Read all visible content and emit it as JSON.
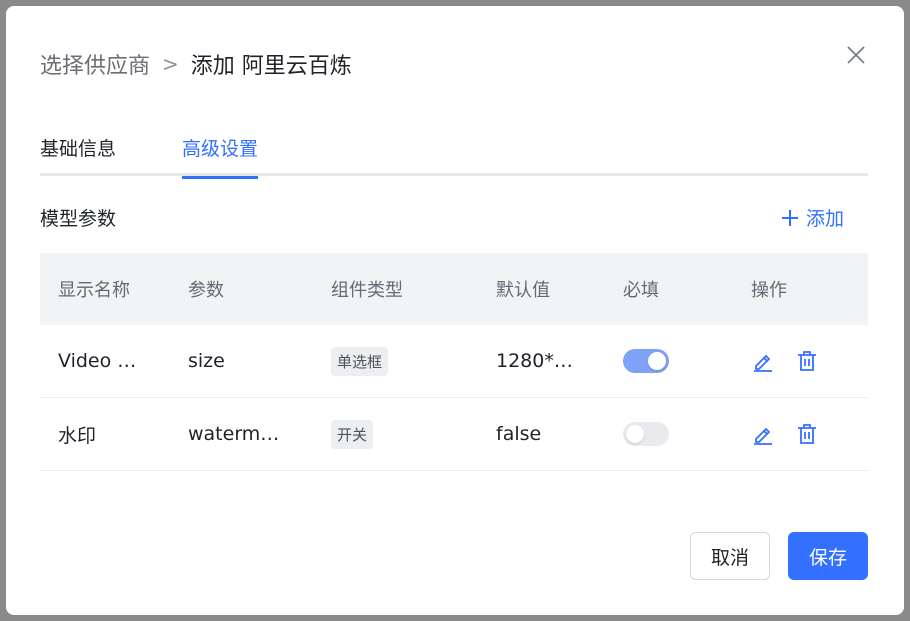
{
  "breadcrumb": {
    "parent": "选择供应商",
    "separator": ">",
    "current": "添加 阿里云百炼"
  },
  "tabs": [
    {
      "label": "基础信息"
    },
    {
      "label": "高级设置"
    }
  ],
  "section": {
    "title": "模型参数",
    "add_label": "添加"
  },
  "table": {
    "headers": [
      "显示名称",
      "参数",
      "组件类型",
      "默认值",
      "必填",
      "操作"
    ],
    "rows": [
      {
        "display_name": "Video …",
        "param": "size",
        "component": "单选框",
        "default": "1280*…",
        "required": true
      },
      {
        "display_name": "水印",
        "param": "waterm…",
        "component": "开关",
        "default": "false",
        "required": false
      }
    ]
  },
  "footer": {
    "cancel_label": "取消",
    "save_label": "保存"
  },
  "colors": {
    "accent": "#3370ff",
    "switch_on": "#7ea2f5",
    "switch_off": "#e8eaed"
  },
  "icons": {
    "close": "close-icon",
    "add": "plus-icon",
    "edit": "edit-icon",
    "delete": "trash-icon"
  }
}
